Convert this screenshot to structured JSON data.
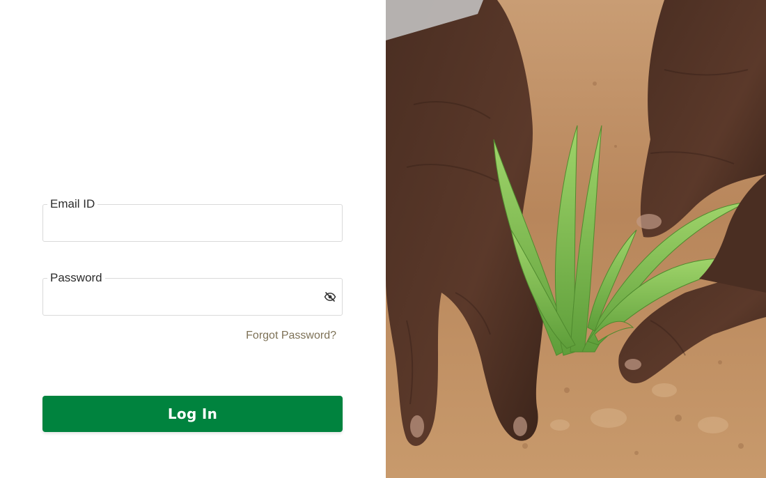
{
  "login_form": {
    "email": {
      "label": "Email ID",
      "value": "",
      "placeholder": ""
    },
    "password": {
      "label": "Password",
      "value": "",
      "placeholder": "",
      "visibility_icon": "eye-off-icon"
    },
    "forgot_password_label": "Forgot Password?",
    "login_button_label": "Log In"
  },
  "hero_image": {
    "subject": "hands-planting-seedlings-photo"
  },
  "colors": {
    "primary_button": "#00833e",
    "forgot_link": "#7d7156",
    "field_border": "#d9d9d9",
    "soil": "#b9875a",
    "leaf": "#7fbf4a"
  }
}
